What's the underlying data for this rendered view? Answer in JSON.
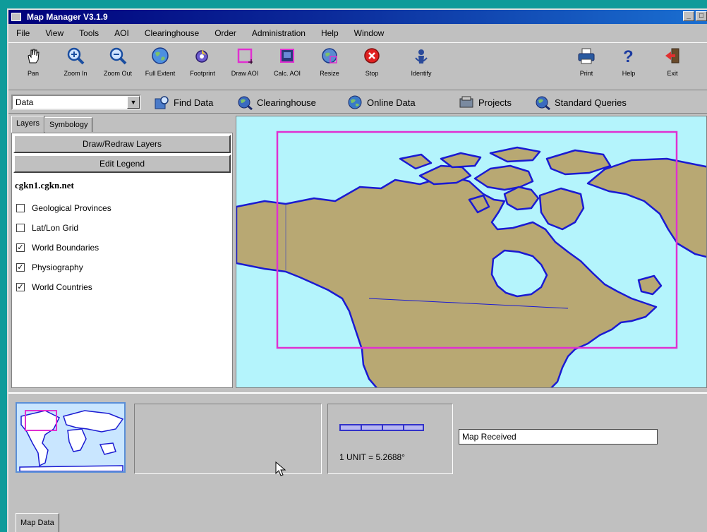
{
  "window": {
    "title": "Map Manager V3.1.9",
    "btn_min": "_",
    "btn_max": "□"
  },
  "menu": [
    "File",
    "View",
    "Tools",
    "AOI",
    "Clearinghouse",
    "Order",
    "Administration",
    "Help",
    "Window"
  ],
  "toolbar": [
    {
      "label": "Pan",
      "icon": "hand-icon"
    },
    {
      "label": "Zoom In",
      "icon": "zoom-in-icon"
    },
    {
      "label": "Zoom Out",
      "icon": "zoom-out-icon"
    },
    {
      "label": "Full Extent",
      "icon": "globe-icon"
    },
    {
      "label": "Footprint",
      "icon": "footprint-icon"
    },
    {
      "label": "Draw AOI",
      "icon": "draw-aoi-icon"
    },
    {
      "label": "Calc. AOI",
      "icon": "calc-aoi-icon"
    },
    {
      "label": "Resize",
      "icon": "resize-icon"
    },
    {
      "label": "Stop",
      "icon": "stop-icon"
    },
    {
      "label": "Identify",
      "icon": "identify-icon"
    },
    {
      "label": "Print",
      "icon": "print-icon"
    },
    {
      "label": "Help",
      "icon": "help-icon"
    },
    {
      "label": "Exit",
      "icon": "exit-icon"
    }
  ],
  "nav": {
    "combo_value": "Data",
    "links": [
      "Find Data",
      "Clearinghouse",
      "Online Data",
      "Projects",
      "Standard Queries"
    ]
  },
  "left_panel": {
    "tabs": [
      "Layers",
      "Symbology"
    ],
    "buttons": [
      "Draw/Redraw Layers",
      "Edit Legend"
    ],
    "server": "cgkn1.cgkn.net",
    "layers": [
      {
        "name": "Geological Provinces",
        "checked": false
      },
      {
        "name": "Lat/Lon Grid",
        "checked": false
      },
      {
        "name": "World Boundaries",
        "checked": true
      },
      {
        "name": "Physiography",
        "checked": true
      },
      {
        "name": "World Countries",
        "checked": true
      }
    ]
  },
  "bottom": {
    "scale_text": "1 UNIT = 5.2688°",
    "status": "Map Received",
    "tab": "Map Data"
  },
  "colors": {
    "land": "#b8a873",
    "water": "#b4f4fc",
    "coast": "#1a1ad2",
    "aoi": "#e030d0"
  }
}
